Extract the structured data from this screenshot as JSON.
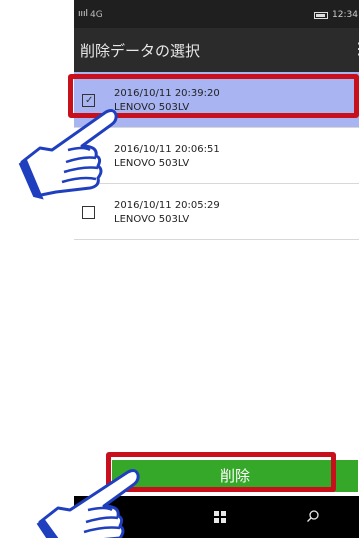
{
  "status_bar": {
    "signal": "ıııl",
    "network": "4G",
    "time": "12:34"
  },
  "app_bar": {
    "title": "削除データの選択",
    "more_glyph": "⋮"
  },
  "records": [
    {
      "date": "2016/10/11 20:39:20",
      "device": "LENOVO 503LV",
      "checked": true
    },
    {
      "date": "2016/10/11 20:06:51",
      "device": "LENOVO 503LV",
      "checked": false
    },
    {
      "date": "2016/10/11 20:05:29",
      "device": "LENOVO 503LV",
      "checked": false
    }
  ],
  "check_glyph": "✓",
  "delete_button": {
    "label": "削除"
  },
  "nav": {
    "windows_icon": "windows-icon",
    "search_icon": "search-icon"
  },
  "colors": {
    "selected_row": "#a9b5f2",
    "highlight_frame": "#c8101c",
    "delete_button": "#36a829",
    "app_bar": "#2b2b2b",
    "hand_outline": "#1f3fbf"
  }
}
